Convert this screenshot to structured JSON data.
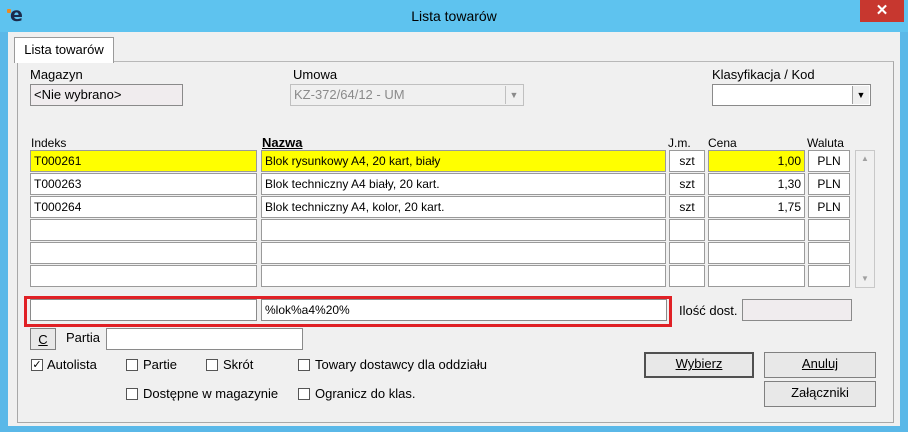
{
  "window": {
    "title": "Lista towarów",
    "icon_letter": "e",
    "close_glyph": "✕"
  },
  "tab": {
    "label": "Lista towarów"
  },
  "magazyn": {
    "label": "Magazyn",
    "value": "<Nie wybrano>"
  },
  "umowa": {
    "label": "Umowa",
    "value": "KZ-372/64/12 - UM"
  },
  "klasyfikacja": {
    "label": "Klasyfikacja / Kod",
    "value": ""
  },
  "table": {
    "headers": {
      "indeks": "Indeks",
      "nazwa": "Nazwa",
      "jm": "J.m.",
      "cena": "Cena",
      "waluta": "Waluta"
    },
    "rows": [
      {
        "indeks": "T000261",
        "nazwa": "Blok rysunkowy A4, 20 kart, biały",
        "jm": "szt",
        "cena": "1,00",
        "waluta": "PLN"
      },
      {
        "indeks": "T000263",
        "nazwa": "Blok techniczny A4 biały, 20 kart.",
        "jm": "szt",
        "cena": "1,30",
        "waluta": "PLN"
      },
      {
        "indeks": "T000264",
        "nazwa": "Blok techniczny A4, kolor, 20 kart.",
        "jm": "szt",
        "cena": "1,75",
        "waluta": "PLN"
      }
    ]
  },
  "search": {
    "indeks_value": "",
    "nazwa_value": "%lok%a4%20%"
  },
  "ilosc": {
    "label": "Ilość dost.",
    "value": ""
  },
  "partia": {
    "button": "C",
    "label": "Partia",
    "value": ""
  },
  "options": {
    "autolista": {
      "label": "Autolista",
      "checked": true
    },
    "partie": {
      "label": "Partie",
      "checked": false
    },
    "skrot": {
      "label": "Skrót",
      "checked": false
    },
    "towary_dostawcy": {
      "label": "Towary dostawcy dla oddziału",
      "checked": false
    },
    "dostepne": {
      "label": "Dostępne w magazynie",
      "checked": false
    },
    "ogranicz": {
      "label": "Ogranicz do klas.",
      "checked": false
    }
  },
  "buttons": {
    "wybierz": "Wybierz",
    "anuluj": "Anuluj",
    "zalaczniki": "Załączniki"
  }
}
